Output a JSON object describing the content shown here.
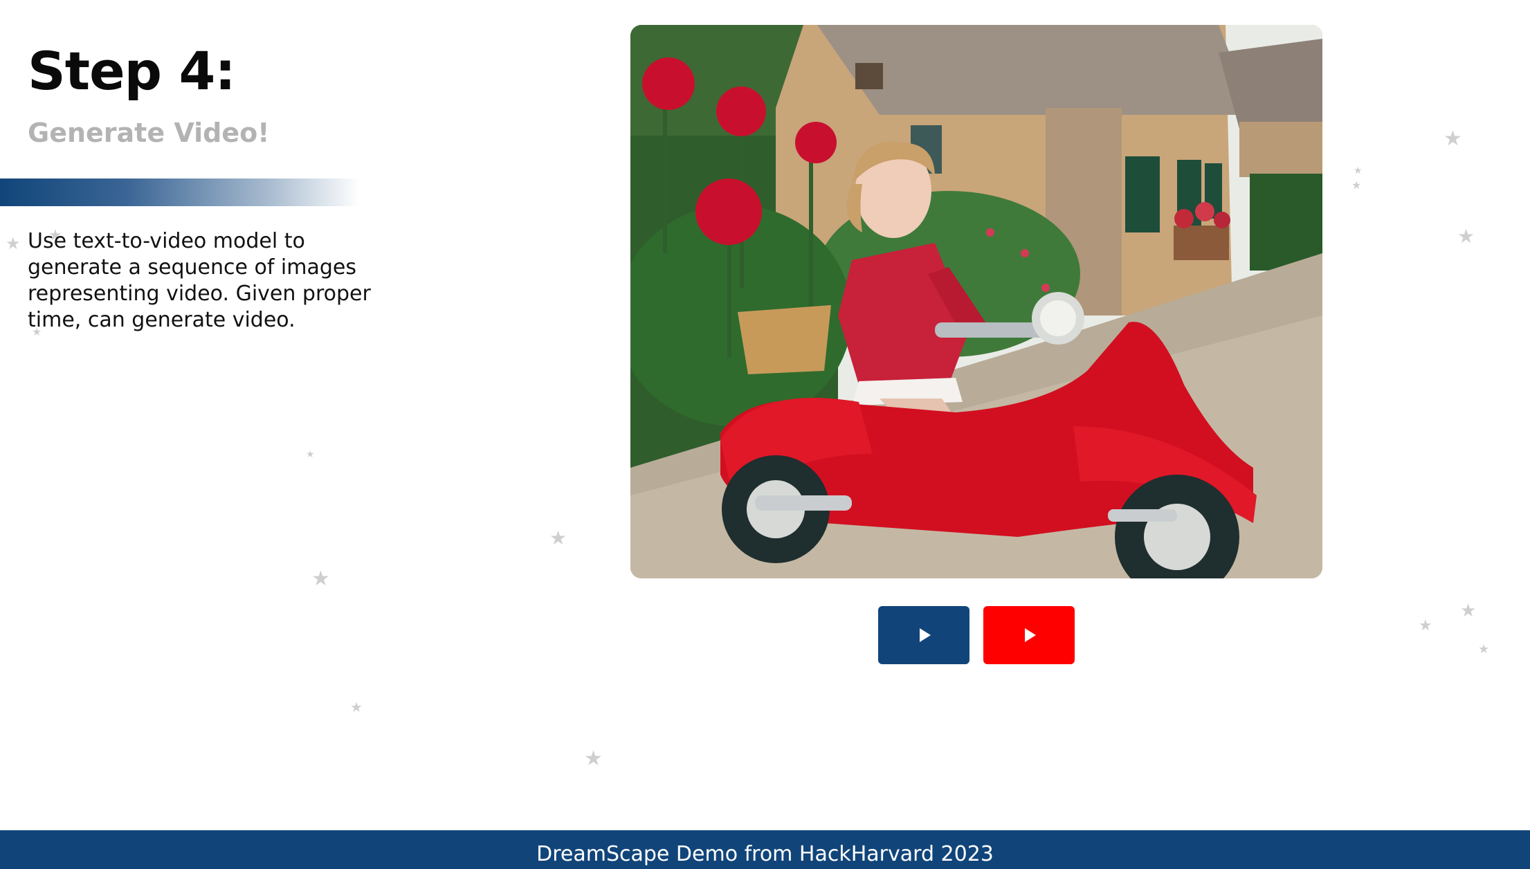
{
  "step": {
    "title": "Step 4:",
    "subtitle": "Generate Video!",
    "description": "Use text-to-video model to generate a sequence of images representing video. Given proper time, can generate video."
  },
  "media": {
    "image_alt": "girl in a red coat riding a red scooter past a cottage with red roses"
  },
  "controls": {
    "play_icon": "play-icon",
    "youtube_icon": "youtube-play-icon"
  },
  "footer": {
    "text": "DreamScape Demo from HackHarvard 2023"
  },
  "colors": {
    "brand_blue": "#11457a",
    "youtube_red": "#ff0000",
    "subtitle_gray": "#b3b3b3"
  }
}
